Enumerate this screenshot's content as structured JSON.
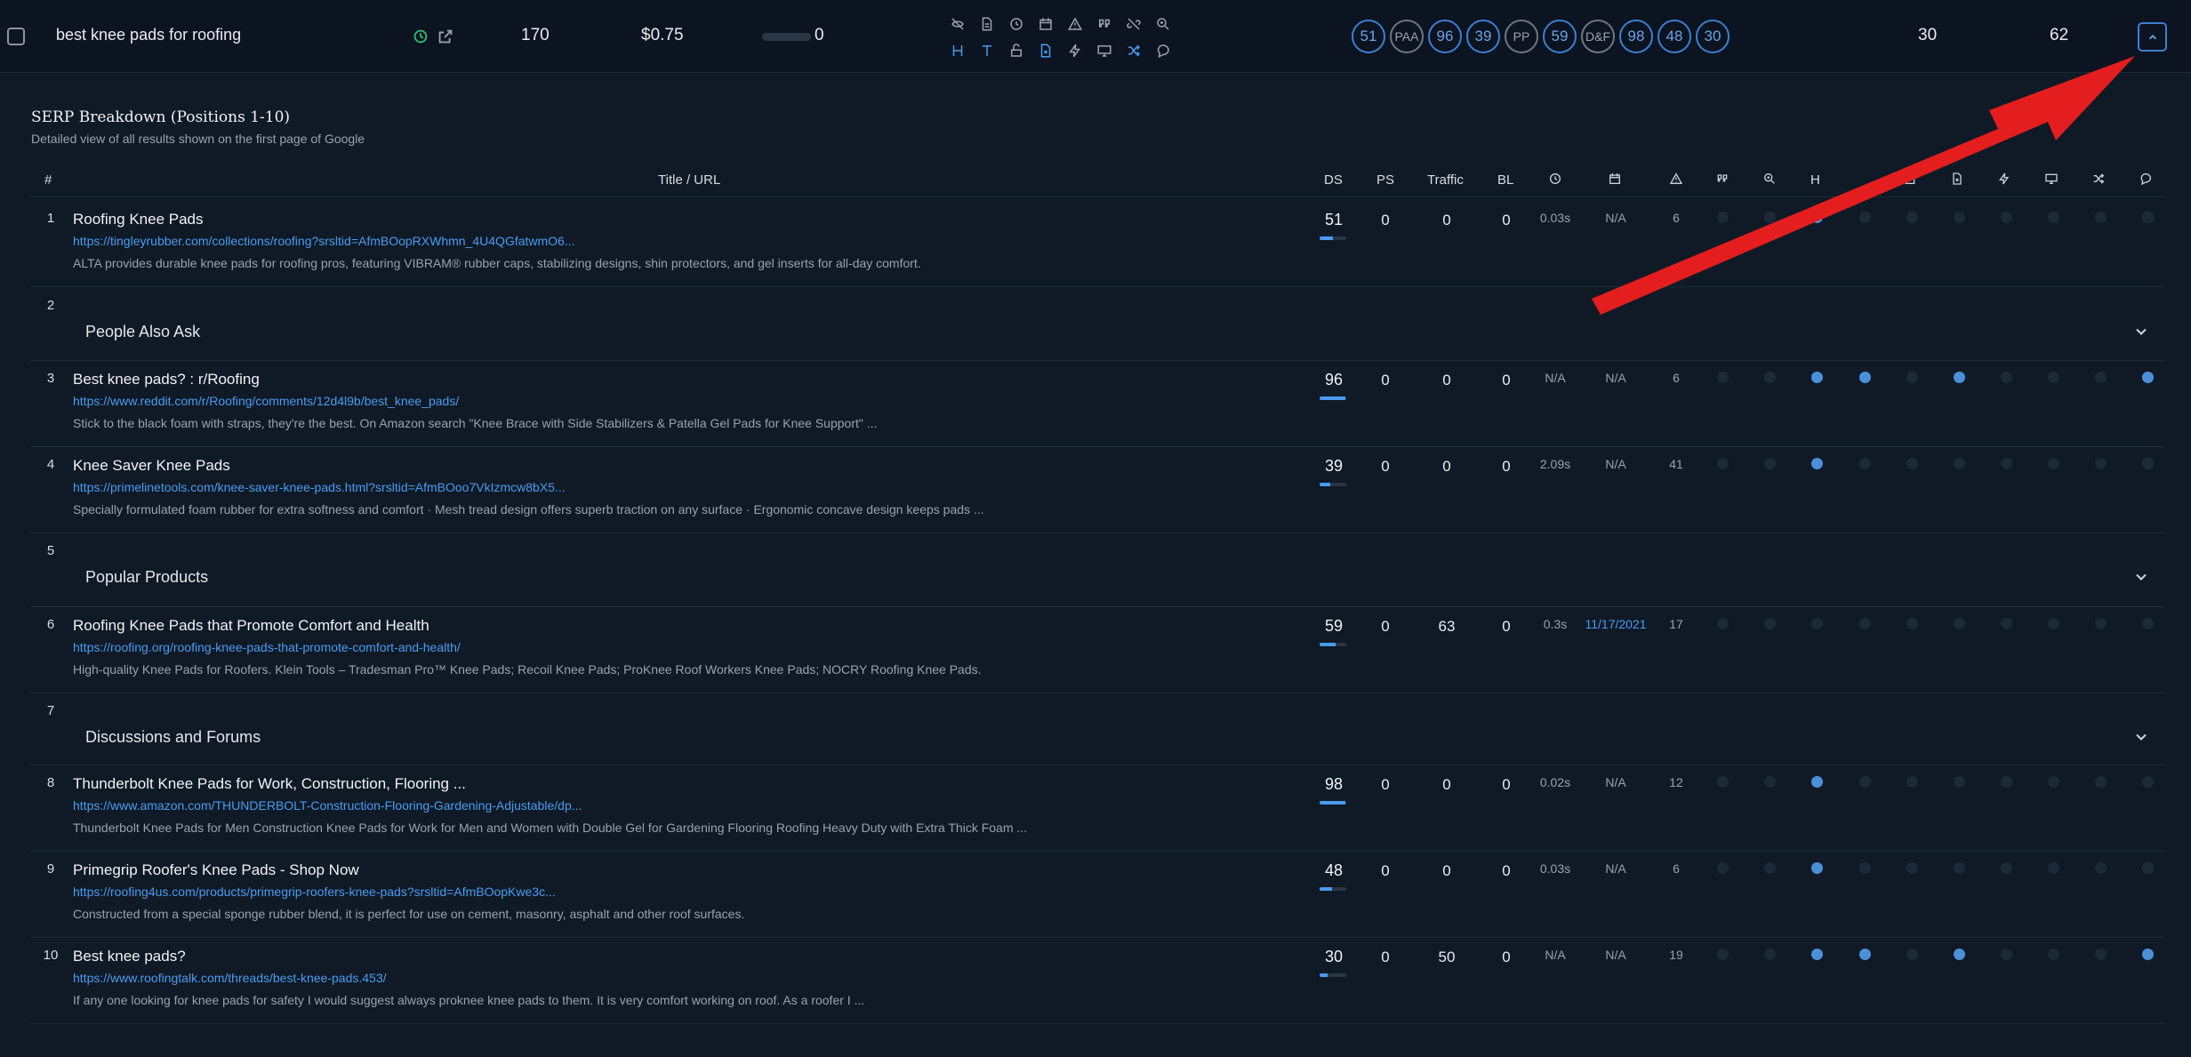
{
  "keyword_row": {
    "keyword": "best knee pads for roofing",
    "volume": "170",
    "cpc": "$0.75",
    "kd": "0",
    "feature_icons": [
      "hide-icon",
      "document-icon",
      "clock-icon",
      "calendar-icon",
      "warning-icon",
      "quote-icon",
      "unlink-icon",
      "zoom-icon",
      "heading-icon",
      "text-icon",
      "lock-open-icon",
      "file-x-icon",
      "bolt-icon",
      "monitor-icon",
      "shuffle-icon",
      "comment-icon"
    ],
    "pills": [
      {
        "label": "51",
        "style": "blue"
      },
      {
        "label": "PAA",
        "style": "grey"
      },
      {
        "label": "96",
        "style": "blue"
      },
      {
        "label": "39",
        "style": "blue"
      },
      {
        "label": "PP",
        "style": "grey"
      },
      {
        "label": "59",
        "style": "blue"
      },
      {
        "label": "D&F",
        "style": "grey"
      },
      {
        "label": "98",
        "style": "blue"
      },
      {
        "label": "48",
        "style": "blue"
      },
      {
        "label": "30",
        "style": "blue"
      }
    ],
    "value_a": "30",
    "value_b": "62"
  },
  "section": {
    "title": "SERP Breakdown (Positions 1-10)",
    "subtitle": "Detailed view of all results shown on the first page of Google"
  },
  "table_header": {
    "num": "#",
    "title_url": "Title / URL",
    "ds": "DS",
    "ps": "PS",
    "traffic": "Traffic",
    "bl": "BL",
    "icon_columns": [
      "clock-icon",
      "calendar-icon",
      "warning-icon",
      "quote-icon",
      "zoom-icon",
      "H",
      "blank",
      "lock-open-icon",
      "file-x-icon",
      "bolt-icon",
      "monitor-icon",
      "shuffle-icon",
      "comment-icon"
    ]
  },
  "rows": [
    {
      "type": "result",
      "num": "1",
      "title": "Roofing Knee Pads",
      "url": "https://tingleyrubber.com/collections/roofing?srsltid=AfmBOopRXWhmn_4U4QGfatwmO6...",
      "desc": "ALTA provides durable knee pads for roofing pros, featuring VIBRAM® rubber caps, stabilizing designs, shin protectors, and gel inserts for all-day comfort.",
      "ds": "51",
      "ds_fill": 0.51,
      "ps": "0",
      "traffic": "0",
      "bl": "0",
      "time": "0.03s",
      "date": "N/A",
      "count": "6",
      "dots": [
        0,
        0,
        1,
        0,
        0,
        0,
        0,
        0,
        0,
        1,
        0
      ]
    },
    {
      "type": "feature",
      "num": "2",
      "label": "People Also Ask"
    },
    {
      "type": "result",
      "num": "3",
      "title": "Best knee pads? : r/Roofing",
      "url": "https://www.reddit.com/r/Roofing/comments/12d4l9b/best_knee_pads/",
      "desc": "Stick to the black foam with straps, they're the best. On Amazon search \"Knee Brace with Side Stabilizers & Patella Gel Pads for Knee Support\" ...",
      "ds": "96",
      "ds_fill": 0.96,
      "ps": "0",
      "traffic": "0",
      "bl": "0",
      "time": "N/A",
      "date": "N/A",
      "count": "6",
      "dots": [
        0,
        0,
        1,
        1,
        0,
        1,
        0,
        0,
        0,
        0,
        1
      ]
    },
    {
      "type": "result",
      "num": "4",
      "title": "Knee Saver Knee Pads",
      "url": "https://primelinetools.com/knee-saver-knee-pads.html?srsltid=AfmBOoo7VkIzmcw8bX5...",
      "desc": "Specially formulated foam rubber for extra softness and comfort · Mesh tread design offers superb traction on any surface · Ergonomic concave design keeps pads ...",
      "ds": "39",
      "ds_fill": 0.39,
      "ps": "0",
      "traffic": "0",
      "bl": "0",
      "time": "2.09s",
      "date": "N/A",
      "count": "41",
      "dots": [
        0,
        0,
        1,
        0,
        0,
        0,
        0,
        0,
        0,
        1,
        0
      ]
    },
    {
      "type": "feature",
      "num": "5",
      "label": "Popular Products"
    },
    {
      "type": "result",
      "num": "6",
      "title": "Roofing Knee Pads that Promote Comfort and Health",
      "url": "https://roofing.org/roofing-knee-pads-that-promote-comfort-and-health/",
      "desc": "High-quality Knee Pads for Roofers. Klein Tools – Tradesman Pro™ Knee Pads; Recoil Knee Pads; ProKnee Roof Workers Knee Pads; NOCRY Roofing Knee Pads.",
      "ds": "59",
      "ds_fill": 0.59,
      "ps": "0",
      "traffic": "63",
      "bl": "0",
      "time": "0.3s",
      "date": "11/17/2021",
      "date_link": true,
      "count": "17",
      "dots": [
        0,
        0,
        0,
        0,
        0,
        0,
        0,
        0,
        0,
        0,
        0
      ]
    },
    {
      "type": "feature",
      "num": "7",
      "label": "Discussions and Forums"
    },
    {
      "type": "result",
      "num": "8",
      "title": "Thunderbolt Knee Pads for Work, Construction, Flooring ...",
      "url": "https://www.amazon.com/THUNDERBOLT-Construction-Flooring-Gardening-Adjustable/dp...",
      "desc": "Thunderbolt Knee Pads for Men Construction Knee Pads for Work for Men and Women with Double Gel for Gardening Flooring Roofing Heavy Duty with Extra Thick Foam ...",
      "ds": "98",
      "ds_fill": 0.98,
      "ps": "0",
      "traffic": "0",
      "bl": "0",
      "time": "0.02s",
      "date": "N/A",
      "count": "12",
      "dots": [
        0,
        0,
        1,
        0,
        0,
        0,
        0,
        0,
        0,
        0,
        0
      ]
    },
    {
      "type": "result",
      "num": "9",
      "title": "Primegrip Roofer's Knee Pads - Shop Now",
      "url": "https://roofing4us.com/products/primegrip-roofers-knee-pads?srsltid=AfmBOopKwe3c...",
      "desc": "Constructed from a special sponge rubber blend, it is perfect for use on cement, masonry, asphalt and other roof surfaces.",
      "ds": "48",
      "ds_fill": 0.48,
      "ps": "0",
      "traffic": "0",
      "bl": "0",
      "time": "0.03s",
      "date": "N/A",
      "count": "6",
      "dots": [
        0,
        0,
        1,
        0,
        0,
        0,
        0,
        0,
        0,
        1,
        0
      ]
    },
    {
      "type": "result",
      "num": "10",
      "title": "Best knee pads?",
      "url": "https://www.roofingtalk.com/threads/best-knee-pads.453/",
      "desc": "If any one looking for knee pads for safety I would suggest always proknee knee pads to them. It is very comfort working on roof. As a roofer I ...",
      "ds": "30",
      "ds_fill": 0.3,
      "ps": "0",
      "traffic": "50",
      "bl": "0",
      "time": "N/A",
      "date": "N/A",
      "count": "19",
      "dots": [
        0,
        0,
        1,
        1,
        0,
        1,
        0,
        0,
        0,
        0,
        1
      ]
    }
  ],
  "colors": {
    "accent": "#4a9bf0",
    "annotation": "#e41e1e",
    "background": "#0f1a26"
  }
}
